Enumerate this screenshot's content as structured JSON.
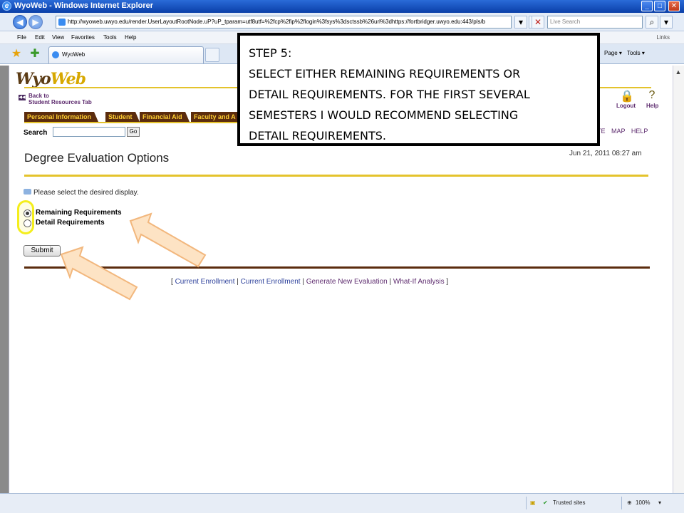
{
  "window": {
    "title": "WyoWeb - Windows Internet Explorer",
    "minimize": "_",
    "maximize": "□",
    "close": "✕"
  },
  "addressbar": {
    "url": "http://wyoweb.uwyo.edu/render.UserLayoutRootNode.uP?uP_tparam=utf8utf=%2fcp%2fip%2flogin%3fsys%3dsctssb%26url%3dhttps://fortbridger.uwyo.edu:443/pls/b",
    "search_placeholder": "Live Search"
  },
  "menubar": {
    "items": [
      "File",
      "Edit",
      "View",
      "Favorites",
      "Tools",
      "Help"
    ],
    "links": "Links"
  },
  "tabbar": {
    "tab_title": "WyoWeb",
    "page_menu": "Page ▾",
    "tools_menu": "Tools ▾"
  },
  "site": {
    "logo_a": "Wyo",
    "logo_b": "Web",
    "back_line1": "Back to",
    "back_line2": "Student Resources Tab",
    "nav_tabs": [
      "Personal Information",
      "Student",
      "Financial Aid",
      "Faculty and A"
    ],
    "search_label": "Search",
    "go_label": "Go",
    "logout_label": "Logout",
    "help_label": "Help",
    "site_links": "TE MAP   HELP"
  },
  "main": {
    "page_title": "Degree Evaluation Options",
    "timestamp": "Jun 21, 2011 08:27 am",
    "instruction": "Please select the desired display.",
    "options": [
      {
        "label": "Remaining Requirements",
        "checked": true
      },
      {
        "label": "Detail Requirements",
        "checked": false
      }
    ],
    "submit_label": "Submit"
  },
  "footer": {
    "open": "[",
    "close": "]",
    "sep": "|",
    "links": [
      "Current Enrollment",
      "Current Enrollment",
      "Generate New Evaluation",
      "What-If Analysis"
    ]
  },
  "callout": {
    "lines": [
      "STEP 5:",
      "SELECT EITHER REMAINING REQUIREMENTS OR",
      "DETAIL REQUIREMENTS. FOR THE FIRST SEVERAL",
      "SEMESTERS I WOULD RECOMMEND SELECTING",
      "DETAIL REQUIREMENTS."
    ]
  },
  "statusbar": {
    "zone": "Trusted sites",
    "zoom": "100%"
  },
  "colors": {
    "nav_tab_bg": "#5b2c0e",
    "nav_tab_text": "#ffcf33",
    "gold_rule": "#e4c32c",
    "highlight": "#f4ee1c",
    "arrow_fill": "#fde3c4",
    "arrow_stroke": "#f2b77d"
  }
}
